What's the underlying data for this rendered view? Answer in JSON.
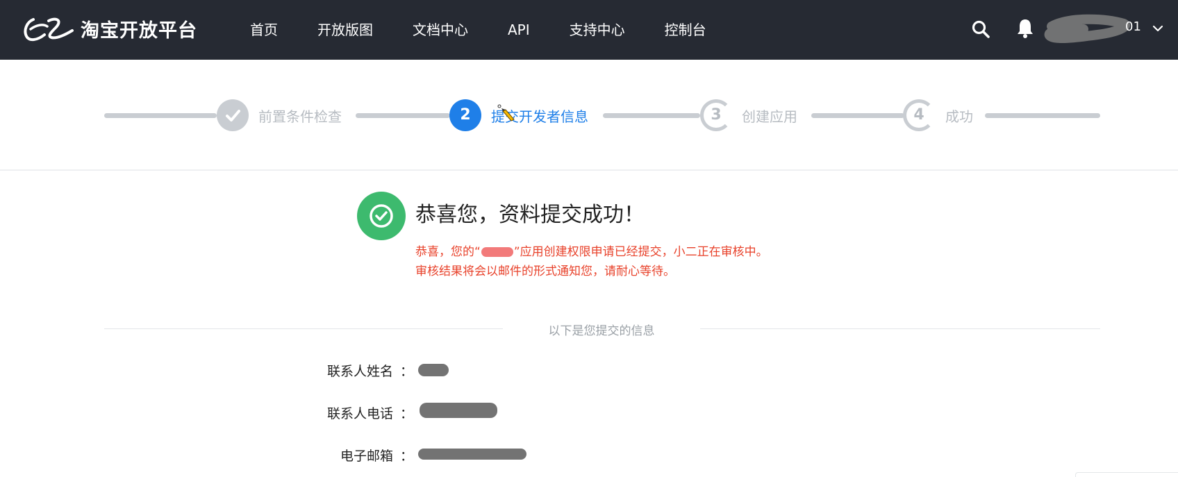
{
  "header": {
    "brand": "淘宝开放平台",
    "nav": [
      {
        "label": "首页",
        "name": "nav-home"
      },
      {
        "label": "开放版图",
        "name": "nav-open-map"
      },
      {
        "label": "文档中心",
        "name": "nav-docs"
      },
      {
        "label": "API",
        "name": "nav-api"
      },
      {
        "label": "支持中心",
        "name": "nav-support"
      },
      {
        "label": "控制台",
        "name": "nav-console"
      }
    ],
    "icons": {
      "search": "search-icon",
      "notifications": "bell-icon",
      "account_menu": "chevron-down-icon"
    },
    "user_suffix": "01"
  },
  "stepper": {
    "steps": [
      {
        "label": "前置条件检查",
        "number": "1",
        "state": "done"
      },
      {
        "label": "提交开发者信息",
        "number": "2",
        "state": "active"
      },
      {
        "label": "创建应用",
        "number": "3",
        "state": "todo"
      },
      {
        "label": "成功",
        "number": "4",
        "state": "todo"
      }
    ],
    "colors": {
      "active": "#1f7fe8",
      "inactive": "#c9cdd2"
    }
  },
  "result": {
    "title": "恭喜您，资料提交成功！",
    "notice_line1_prefix": "恭喜，您的“",
    "notice_line1_suffix": "”应用创建权限申请已经提交，小二正在审核中。",
    "notice_line2": "审核结果将会以邮件的形式通知您，请耐心等待。",
    "colors": {
      "success": "#3dba6e",
      "notice": "#e8412a"
    }
  },
  "submitted_info": {
    "heading": "以下是您提交的信息",
    "rows": [
      {
        "label": "联系人姓名",
        "colon": "："
      },
      {
        "label": "联系人电话",
        "colon": "："
      },
      {
        "label": "电子邮箱",
        "colon": "："
      }
    ]
  }
}
